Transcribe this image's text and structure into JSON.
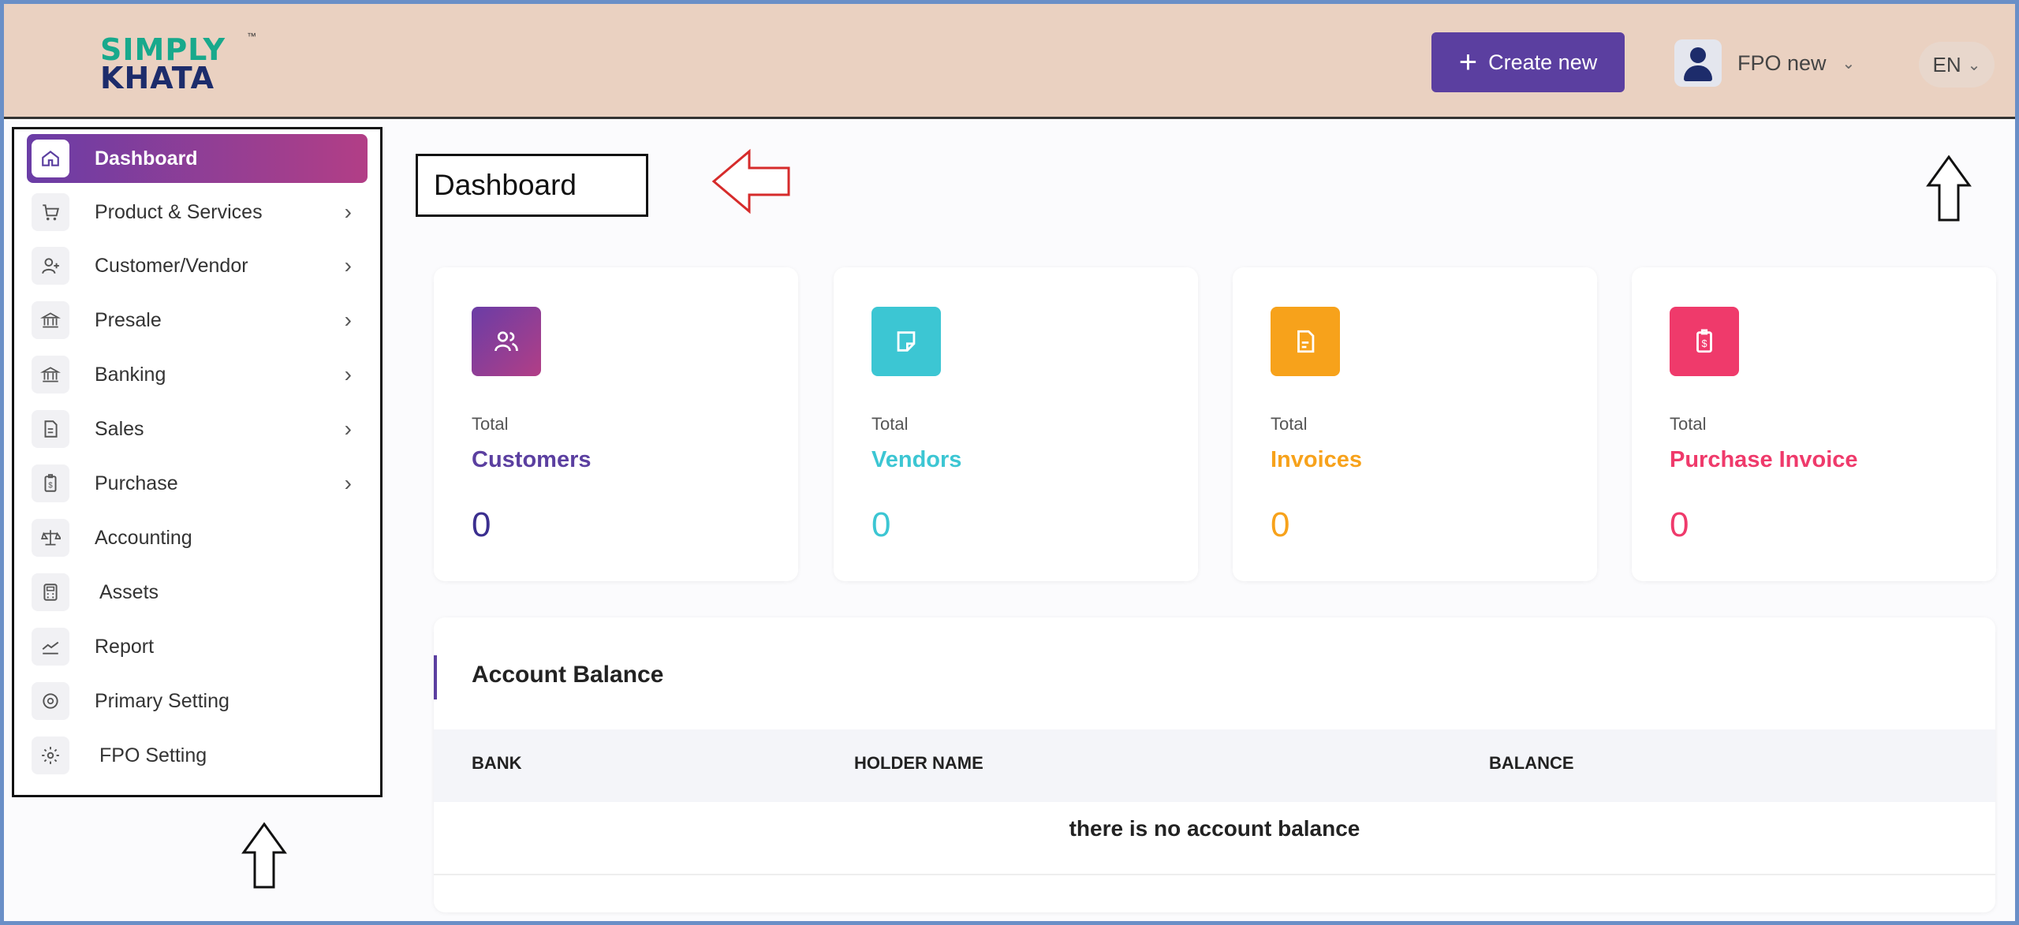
{
  "app": {
    "logo_line1": "SIMPLY",
    "logo_line2": "KHATA",
    "logo_tm": "™"
  },
  "header": {
    "create_label": "Create new",
    "user_name": "FPO new",
    "language": "EN"
  },
  "sidebar": {
    "items": [
      {
        "label": "Dashboard",
        "icon": "home-icon",
        "has_arrow": false,
        "active": true
      },
      {
        "label": "Product & Services",
        "icon": "cart-icon",
        "has_arrow": true
      },
      {
        "label": "Customer/Vendor",
        "icon": "add-user-icon",
        "has_arrow": true
      },
      {
        "label": "Presale",
        "icon": "bank-icon",
        "has_arrow": true
      },
      {
        "label": "Banking",
        "icon": "bank-icon",
        "has_arrow": true
      },
      {
        "label": "Sales",
        "icon": "document-icon",
        "has_arrow": true
      },
      {
        "label": "Purchase",
        "icon": "receipt-icon",
        "has_arrow": true
      },
      {
        "label": "Accounting",
        "icon": "scale-icon",
        "has_arrow": false
      },
      {
        "label": "Assets",
        "icon": "calculator-icon",
        "has_arrow": false
      },
      {
        "label": "Report",
        "icon": "chart-icon",
        "has_arrow": false
      },
      {
        "label": "Primary Setting",
        "icon": "cog-circle-icon",
        "has_arrow": false
      },
      {
        "label": "FPO Setting",
        "icon": "gear-icon",
        "has_arrow": false
      }
    ],
    "arrow_glyph": "›"
  },
  "main": {
    "page_title": "Dashboard",
    "cards": [
      {
        "total_label": "Total",
        "name": "Customers",
        "value": "0",
        "color": "#5b3fa0",
        "icon": "users-icon"
      },
      {
        "total_label": "Total",
        "name": "Vendors",
        "value": "0",
        "color": "#3cc6d3",
        "icon": "note-icon"
      },
      {
        "total_label": "Total",
        "name": "Invoices",
        "value": "0",
        "color": "#f7a21b",
        "icon": "invoice-icon"
      },
      {
        "total_label": "Total",
        "name": "Purchase Invoice",
        "value": "0",
        "color": "#ef3a6b",
        "icon": "clipboard-icon"
      }
    ],
    "account_balance": {
      "title": "Account Balance",
      "columns": [
        "BANK",
        "HOLDER NAME",
        "BALANCE"
      ],
      "empty_message": "there is no account balance"
    }
  },
  "colors": {
    "header_bg": "#ead1c1",
    "accent": "#5b3fa0",
    "active_gradient_start": "#6a3da6",
    "active_gradient_end": "#b23e86",
    "frame_border": "#6a8fc7",
    "annotation_red": "#d62b2b"
  }
}
